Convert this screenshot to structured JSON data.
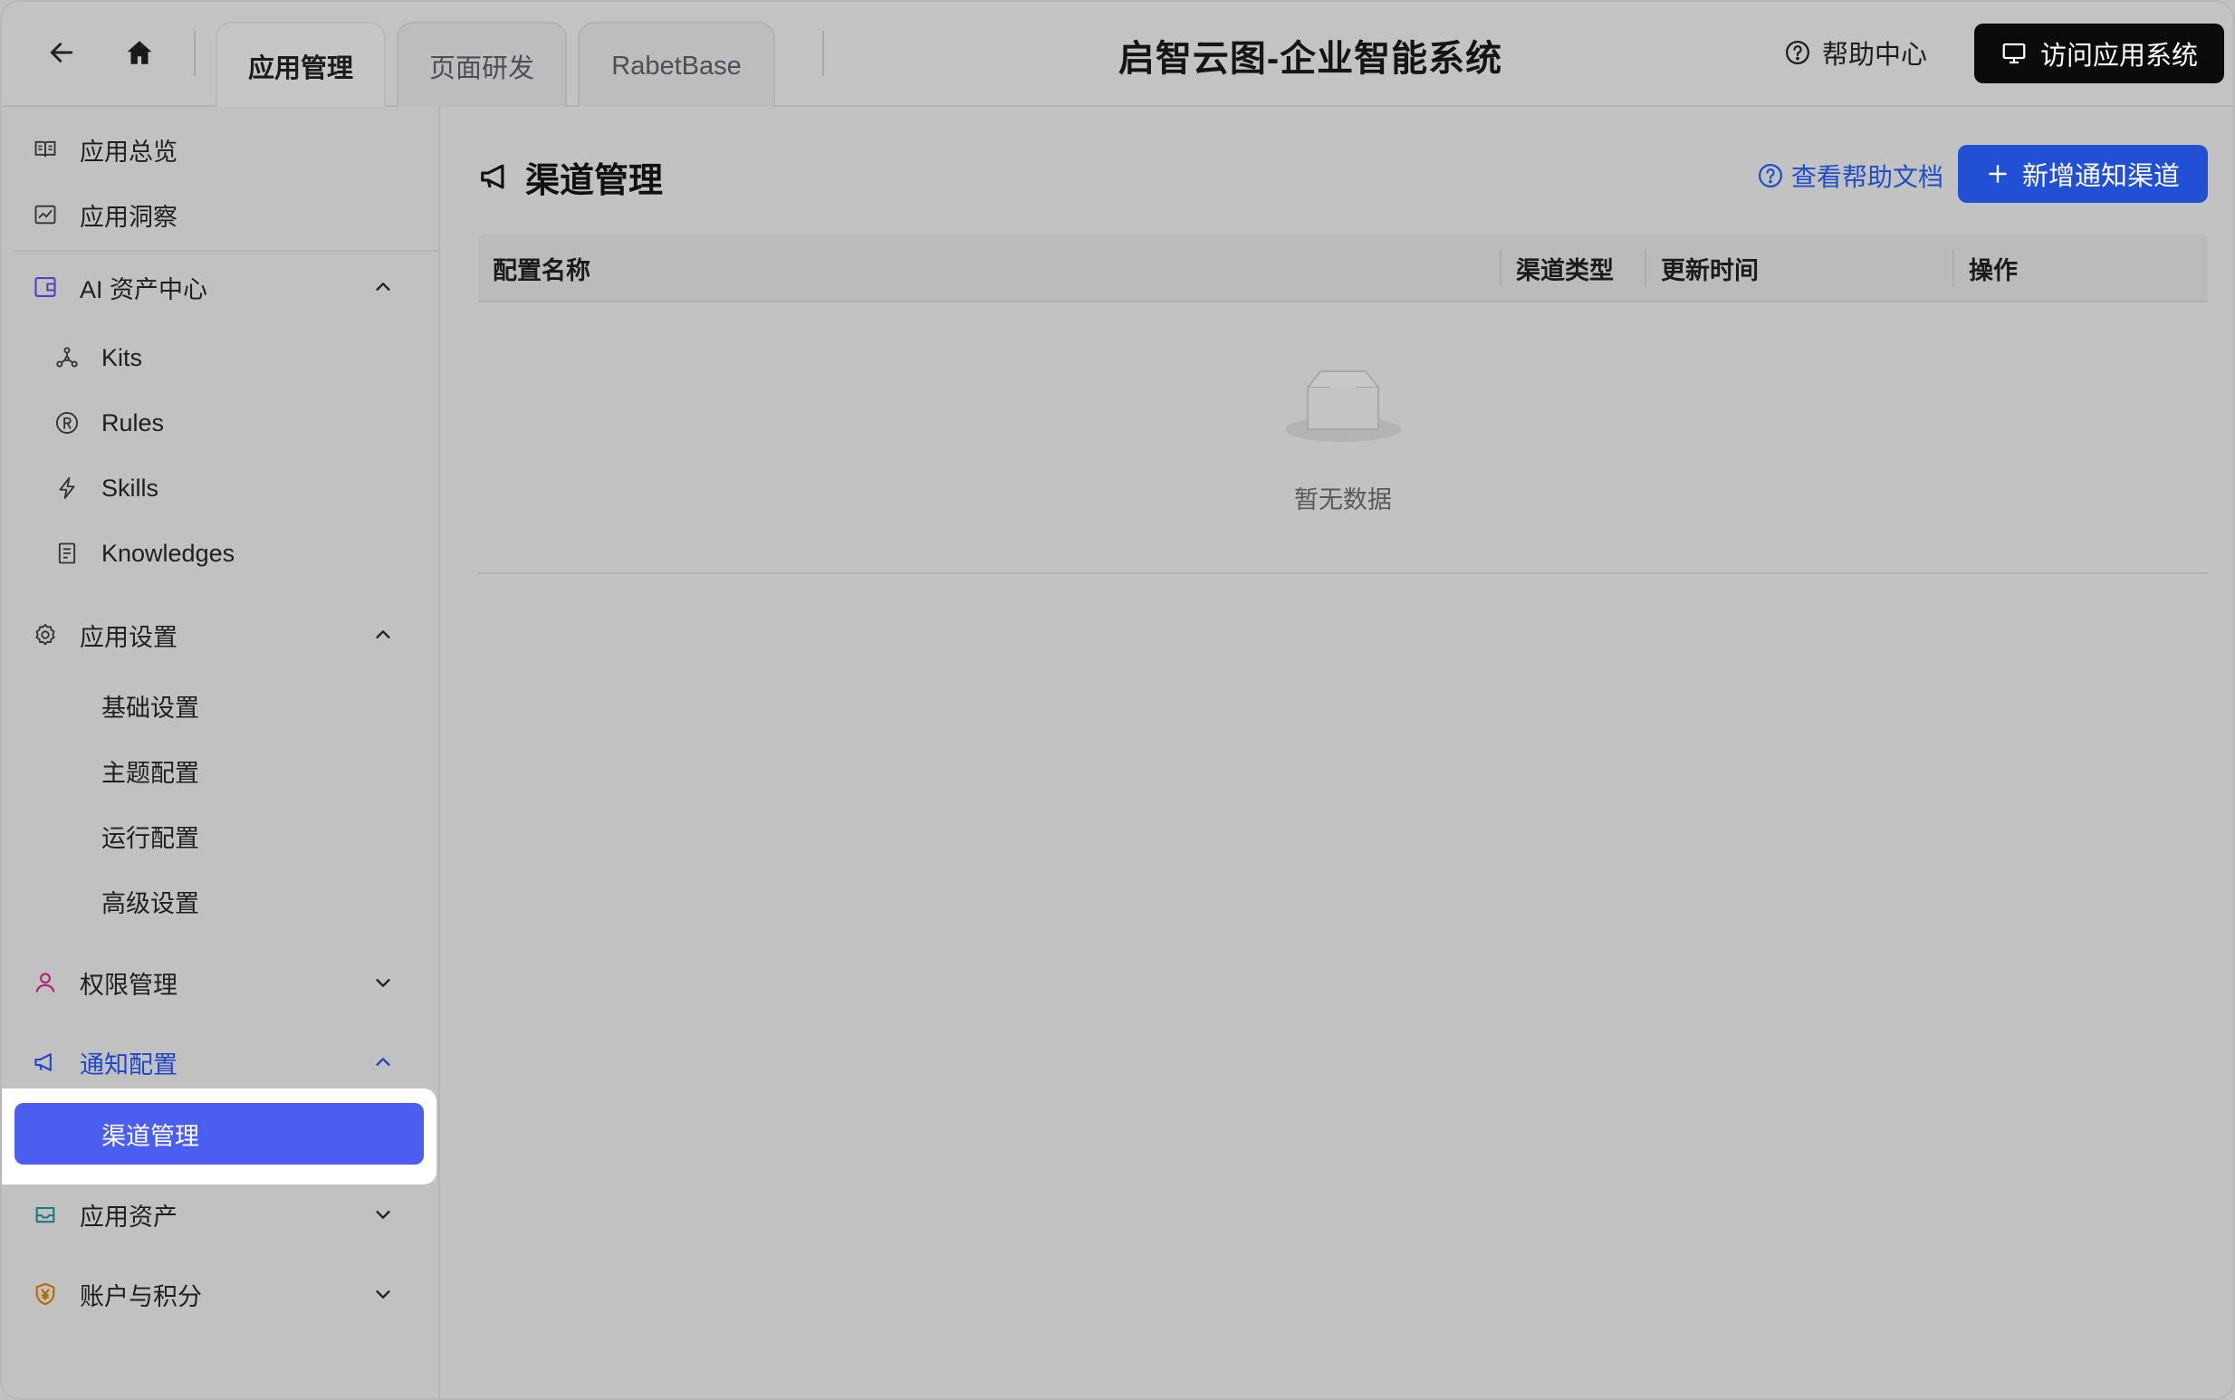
{
  "colors": {
    "accent": "#4b5ef0",
    "primary_button": "#2250d4",
    "link": "#1e4fc9",
    "dark_button": "#0b0b0b"
  },
  "topbar": {
    "back_icon": "arrow-left-icon",
    "home_icon": "home-icon",
    "tabs": [
      {
        "label": "应用管理",
        "active": true
      },
      {
        "label": "页面研发",
        "active": false
      },
      {
        "label": "RabetBase",
        "active": false
      }
    ],
    "title": "启智云图-企业智能系统",
    "help_center": "帮助中心",
    "visit_button": "访问应用系统"
  },
  "sidebar": {
    "overview": "应用总览",
    "insight": "应用洞察",
    "ai_assets": {
      "label": "AI 资产中心",
      "items": [
        "Kits",
        "Rules",
        "Skills",
        "Knowledges"
      ]
    },
    "app_settings": {
      "label": "应用设置",
      "items": [
        "基础设置",
        "主题配置",
        "运行配置",
        "高级设置"
      ]
    },
    "permissions": "权限管理",
    "notify_config": {
      "label": "通知配置",
      "items": [
        "渠道管理"
      ]
    },
    "app_assets": "应用资产",
    "account_points": "账户与积分"
  },
  "main": {
    "title": "渠道管理",
    "help_doc": "查看帮助文档",
    "add_button": "新增通知渠道",
    "table": {
      "columns": [
        "配置名称",
        "渠道类型",
        "更新时间",
        "操作"
      ],
      "rows": [],
      "empty_text": "暂无数据"
    }
  }
}
